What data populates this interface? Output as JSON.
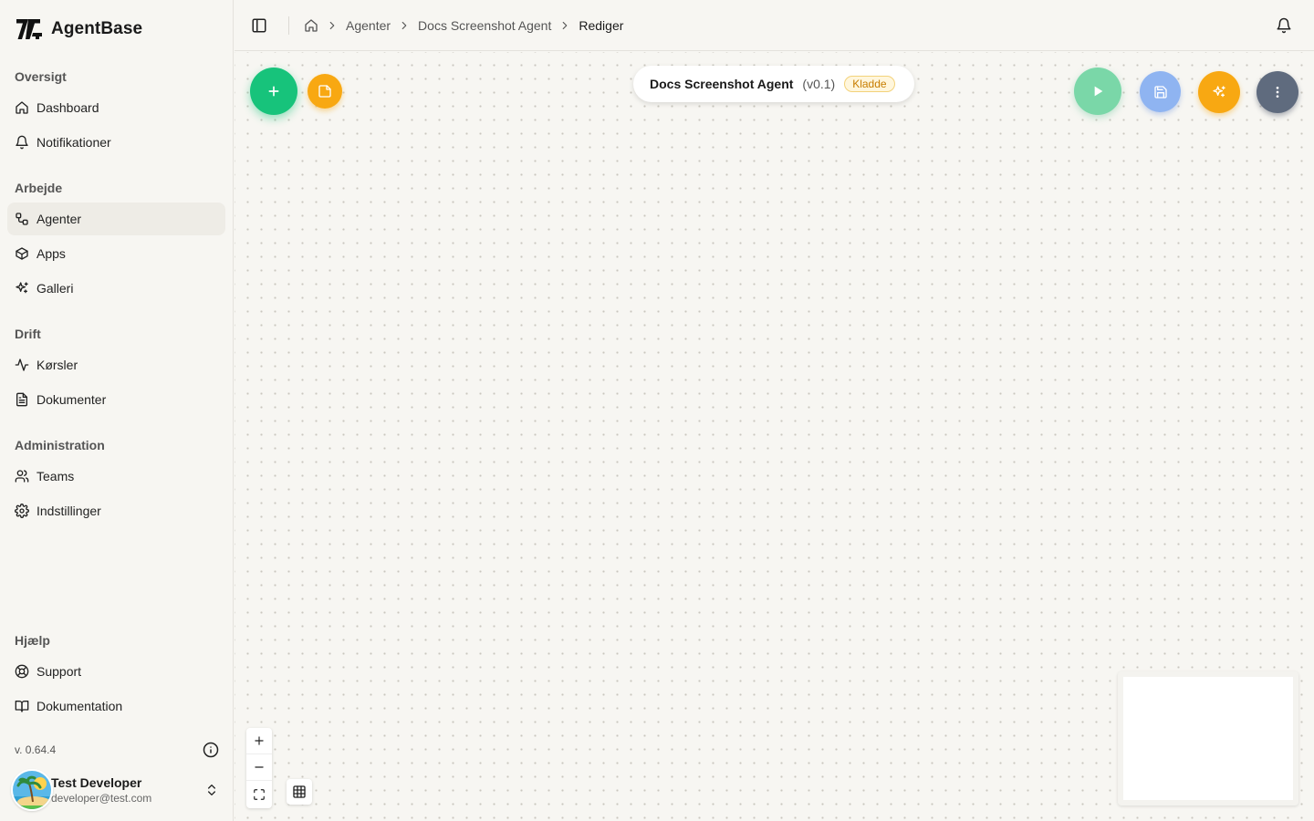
{
  "brand": {
    "name": "AgentBase"
  },
  "sidebar": {
    "sections": [
      {
        "title": "Oversigt",
        "items": [
          {
            "label": "Dashboard",
            "icon": "home-icon"
          },
          {
            "label": "Notifikationer",
            "icon": "bell-icon"
          }
        ]
      },
      {
        "title": "Arbejde",
        "items": [
          {
            "label": "Agenter",
            "icon": "workflow-icon",
            "active": true
          },
          {
            "label": "Apps",
            "icon": "box-icon"
          },
          {
            "label": "Galleri",
            "icon": "sparkles-icon"
          }
        ]
      },
      {
        "title": "Drift",
        "items": [
          {
            "label": "Kørsler",
            "icon": "activity-icon"
          },
          {
            "label": "Dokumenter",
            "icon": "file-text-icon"
          }
        ]
      },
      {
        "title": "Administration",
        "items": [
          {
            "label": "Teams",
            "icon": "users-icon"
          },
          {
            "label": "Indstillinger",
            "icon": "gear-icon"
          }
        ]
      },
      {
        "title": "Hjælp",
        "items": [
          {
            "label": "Support",
            "icon": "lifebuoy-icon"
          },
          {
            "label": "Dokumentation",
            "icon": "book-icon"
          }
        ]
      }
    ],
    "version": "v. 0.64.4",
    "user": {
      "name": "Test Developer",
      "email": "developer@test.com"
    }
  },
  "header": {
    "breadcrumb": [
      "Agenter",
      "Docs Screenshot Agent",
      "Rediger"
    ]
  },
  "canvas": {
    "agent_name": "Docs Screenshot Agent",
    "agent_version": "(v0.1)",
    "status_badge": "Kladde"
  },
  "colors": {
    "accent_green": "#17c37b",
    "accent_orange": "#f8a812",
    "accent_blue": "#8fb4f1",
    "accent_slate": "#5f6b7e",
    "background": "#f7f6f2"
  }
}
